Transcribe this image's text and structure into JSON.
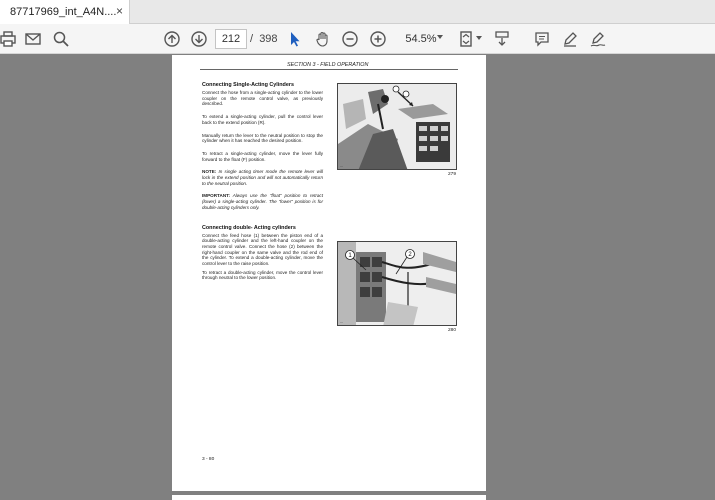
{
  "tab": {
    "title": "87717969_int_A4N....",
    "close": "×"
  },
  "toolbar": {
    "page_current": "212",
    "page_separator": "/",
    "page_total": "398",
    "zoom": "54.5%",
    "icons": [
      "print-icon",
      "mail-icon",
      "search-icon",
      "page-up-icon",
      "page-down-icon",
      "select-cursor-icon",
      "hand-tool-icon",
      "zoom-out-icon",
      "zoom-in-icon",
      "fit-page-icon",
      "scroll-mode-icon",
      "comment-icon",
      "highlight-icon",
      "sign-icon"
    ]
  },
  "document": {
    "section_header": "SECTION 3 - FIELD OPERATION",
    "single_heading": "Connecting Single-Acting Cylinders",
    "single_p1": "Connect the hose from a single-acting cylinder to the lower coupler on the remote control valve, as previously described.",
    "single_p2": "To extend a single-acting cylinder, pull the control lever back to the extend position (R).",
    "single_p3": "Manually return the lever to the neutral position to stop the cylinder when it has reached the desired position.",
    "single_p4": "To retract a single-acting cylinder, move the lever fully forward to the float (F) position.",
    "note_label": "NOTE:",
    "note_text": " In single acting timer mode the remote lever will lock in the extend position and will not automatically return to the neutral position.",
    "important_label": "IMPORTANT:",
    "important_text": " Always use the \"float\" position to retract (lower) a single-acting cylinder. The \"lower\" position is for double-acting cylinders only.",
    "double_heading": "Connecting double- Acting cylinders",
    "double_p1": "Connect the feed hose (1) between the piston end of a double-acting cylinder and the left-hand coupler on the remote control valve. Connect the hose (2) between the right-hand coupler on the same valve and the rod end of the cylinder. To extend a double-acting cylinder, move the control lever to the raise position.",
    "double_p2": "To retract a double-acting cylinder, move the control lever through neutral to the lower position.",
    "fig1_number": "279",
    "fig2_number": "280",
    "fig2_label1": "1",
    "fig2_label2": "2",
    "page_number": "3 - 80"
  }
}
